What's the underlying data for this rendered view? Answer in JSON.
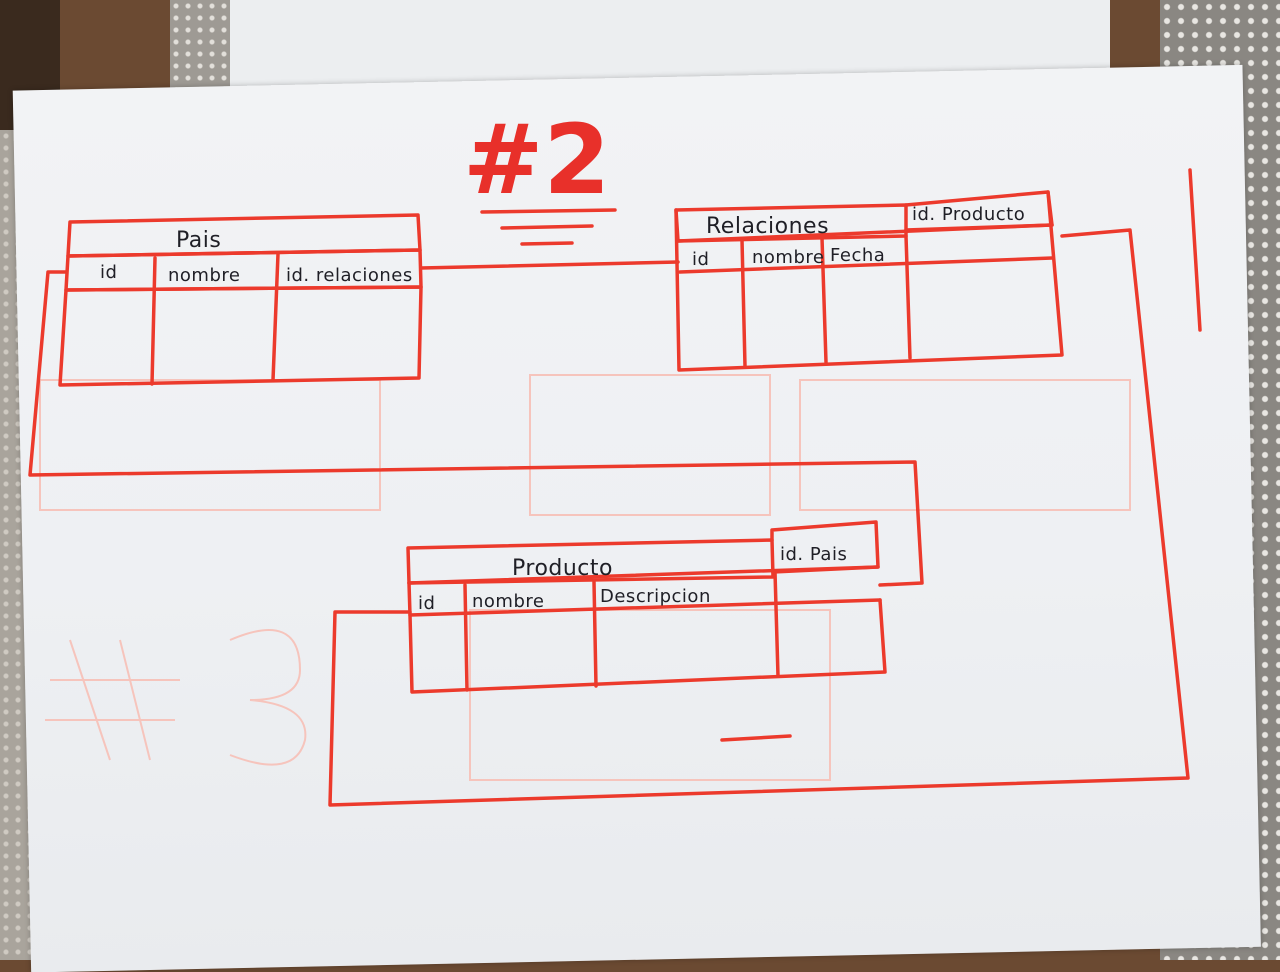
{
  "page_title": "#2",
  "tables": {
    "pais": {
      "name": "Pais",
      "columns": [
        "id",
        "nombre",
        "id. relaciones"
      ]
    },
    "relaciones": {
      "name": "Relaciones",
      "fk": "id. Producto",
      "columns": [
        "id",
        "nombre",
        "Fecha"
      ]
    },
    "producto": {
      "name": "Producto",
      "fk": "id. Pais",
      "columns": [
        "id",
        "nombre",
        "Descripcion"
      ]
    }
  },
  "colors": {
    "ink": "#ec3a2c",
    "pencil": "#1f1f26",
    "paper": "#f2f3f5"
  }
}
